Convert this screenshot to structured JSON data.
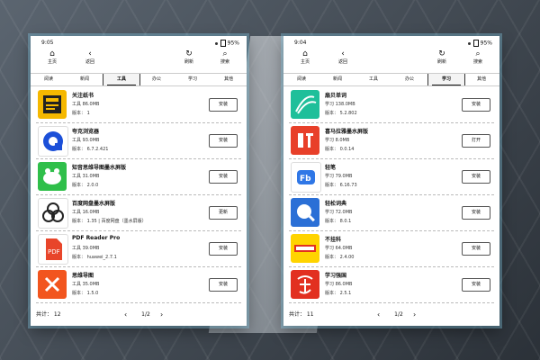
{
  "screens": [
    {
      "status": {
        "time": "9:05",
        "battery": "95%"
      },
      "toolbar": {
        "home": "主页",
        "back": "返回",
        "refresh": "刷新",
        "search": "搜索"
      },
      "tabs": [
        "阅读",
        "新闻",
        "工具",
        "办公",
        "学习",
        "其他"
      ],
      "active_tab": 2,
      "apps": [
        {
          "name": "关注纸书",
          "meta": "工具 86.0MB",
          "version": "版本： 1",
          "action": "安装",
          "icon": "zhishu-icon",
          "color": "#f5b800"
        },
        {
          "name": "夸克浏览器",
          "meta": "工具 93.0MB",
          "version": "版本： 6.7.2.421",
          "action": "安装",
          "icon": "quark-icon",
          "color": "#1b4fd8"
        },
        {
          "name": "知音思维导图墨水屏版",
          "meta": "工具 31.0MB",
          "version": "版本： 2.0.0",
          "action": "安装",
          "icon": "mindmap-icon",
          "color": "#2fbf4a"
        },
        {
          "name": "百度网盘墨水屏版",
          "meta": "工具 16.0MB",
          "version": "版本： 1.35 | 百度网盘（墨水屏版）",
          "action": "更新",
          "icon": "baidupan-icon",
          "color": "#222222"
        },
        {
          "name": "PDF Reader Pro",
          "meta": "工具 39.0MB",
          "version": "版本： huawei_2.7.1",
          "action": "安装",
          "icon": "pdf-icon",
          "color": "#e8452a"
        },
        {
          "name": "思维导图",
          "meta": "工具 35.0MB",
          "version": "版本： 1.5.0",
          "action": "安装",
          "icon": "xmind-icon",
          "color": "#f2551e"
        }
      ],
      "footer": {
        "count": "共计： 12",
        "page": "1/2"
      }
    },
    {
      "status": {
        "time": "9:04",
        "battery": "95%"
      },
      "toolbar": {
        "home": "主页",
        "back": "返回",
        "refresh": "刷新",
        "search": "搜索"
      },
      "tabs": [
        "阅读",
        "新闻",
        "工具",
        "办公",
        "学习",
        "其他"
      ],
      "active_tab": 4,
      "apps": [
        {
          "name": "扇贝单词",
          "meta": "学习 138.0MB",
          "version": "版本： 5.2.802",
          "action": "安装",
          "icon": "shanbay-icon",
          "color": "#1fbf9a"
        },
        {
          "name": "喜马拉雅墨水屏版",
          "meta": "学习 8.0MB",
          "version": "版本： 0.0.14",
          "action": "打开",
          "icon": "ximalaya-icon",
          "color": "#e8402a"
        },
        {
          "name": "轻笔",
          "meta": "学习 79.0MB",
          "version": "版本： 6.16.73",
          "action": "安装",
          "icon": "fb-icon",
          "color": "#2f77e6"
        },
        {
          "name": "轻松词典",
          "meta": "学习 72.0MB",
          "version": "版本： 8.0.1",
          "action": "安装",
          "icon": "dict-icon",
          "color": "#2a6fd6"
        },
        {
          "name": "不挂科",
          "meta": "学习 64.0MB",
          "version": "版本： 2.4.00",
          "action": "安装",
          "icon": "buguake-icon",
          "color": "#ffd400"
        },
        {
          "name": "学习强国",
          "meta": "学习 86.0MB",
          "version": "版本： 2.5.1",
          "action": "安装",
          "icon": "xuexi-icon",
          "color": "#e23020"
        }
      ],
      "footer": {
        "count": "共计： 11",
        "page": "1/2"
      }
    }
  ]
}
